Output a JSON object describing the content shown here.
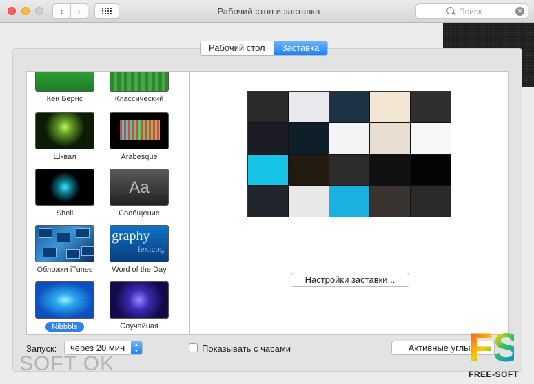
{
  "window": {
    "title": "Рабочий стол и заставка"
  },
  "search": {
    "placeholder": "Поиск"
  },
  "tabs": [
    {
      "label": "Рабочий стол",
      "active": false
    },
    {
      "label": "Заставка",
      "active": true
    }
  ],
  "screensavers": [
    {
      "label": "Кен Бернс",
      "selected": false
    },
    {
      "label": "Классический",
      "selected": false
    },
    {
      "label": "Шквал",
      "selected": false
    },
    {
      "label": "Arabesque",
      "selected": false
    },
    {
      "label": "Shell",
      "selected": false
    },
    {
      "label": "Сообщение",
      "selected": false,
      "thumb_text": "Aa"
    },
    {
      "label": "Обложки iTunes",
      "selected": false
    },
    {
      "label": "Word of the Day",
      "selected": false,
      "thumb_text": "graphy",
      "thumb_text2": "lexicog"
    },
    {
      "label": "Nibbble",
      "selected": true
    },
    {
      "label": "Случайная",
      "selected": false
    }
  ],
  "preview": {
    "tile_colors": [
      "#2a2a2a",
      "#e9e9ee",
      "#1d3345",
      "#f3e6d3",
      "#2f2f2f",
      "#1c1c24",
      "#0f1f2a",
      "#f4f4f6",
      "#e7ddd0",
      "#f7f7f7",
      "#16c4e6",
      "#231b12",
      "#2c2c2c",
      "#101010",
      "#050505",
      "#20262b",
      "#e8e8e8",
      "#1ab0e0",
      "#3a3430",
      "#2a2a2a"
    ]
  },
  "buttons": {
    "settings": "Настройки заставки...",
    "hot_corners": "Активные углы..."
  },
  "start": {
    "label": "Запуск:",
    "value": "через 20 мин"
  },
  "show_clock": {
    "label": "Показывать с часами",
    "checked": false
  },
  "watermarks": {
    "left": "SOFT OK",
    "logo": "FS",
    "logo_sub": "FREE-SOFT"
  }
}
